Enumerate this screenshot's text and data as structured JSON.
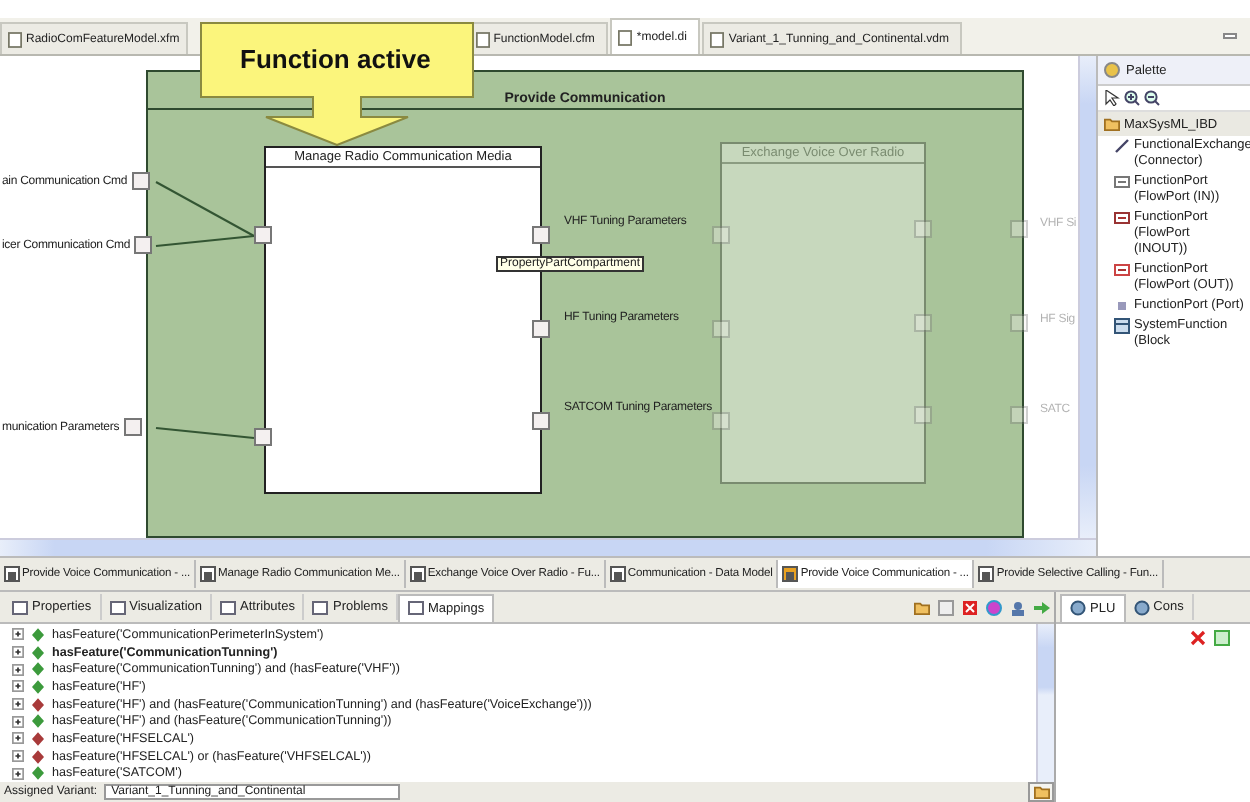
{
  "editor_tabs": [
    {
      "label": "RadioComFeatureModel.xfm",
      "selected": false
    },
    {
      "label": "FunctionModel.cfm",
      "selected": false
    },
    {
      "label": "*model.di",
      "selected": true
    },
    {
      "label": "Variant_1_Tunning_and_Continental.vdm",
      "selected": false
    }
  ],
  "callout": {
    "text": "Function active"
  },
  "diagram": {
    "frame_title": "Provide Communication",
    "blocks": [
      {
        "title": "Manage Radio Communication Media",
        "faded": false
      },
      {
        "title": "Exchange Voice Over Radio",
        "faded": true
      }
    ],
    "inputs": [
      "ain Communication Cmd",
      "icer Communication Cmd",
      "munication Parameters"
    ],
    "block_outputs": [
      "VHF Tuning Parameters",
      "HF Tuning Parameters",
      "SATCOM Tuning Parameters"
    ],
    "tooltip": "PropertyPartCompartment",
    "outputs": [
      "VHF Si",
      "HF Sig",
      "SATC"
    ]
  },
  "palette": {
    "title": "Palette",
    "drawer": "MaxSysML_IBD",
    "items": [
      {
        "label": "FunctionalExchange (Connector)",
        "kind": "connector"
      },
      {
        "label": "FunctionPort (FlowPort (IN))",
        "kind": "in"
      },
      {
        "label": "FunctionPort (FlowPort (INOUT))",
        "kind": "inout"
      },
      {
        "label": "FunctionPort (FlowPort (OUT))",
        "kind": "out"
      },
      {
        "label": "FunctionPort (Port)",
        "kind": "port"
      },
      {
        "label": "SystemFunction (Block",
        "kind": "block"
      }
    ]
  },
  "diagram_tabs": [
    {
      "label": "Provide Voice Communication - ...",
      "selected": false
    },
    {
      "label": "Manage Radio Communication Me...",
      "selected": false
    },
    {
      "label": "Exchange Voice Over Radio - Fu...",
      "selected": false
    },
    {
      "label": "Communication - Data Model",
      "selected": false
    },
    {
      "label": "Provide Voice Communication - ...",
      "selected": true
    },
    {
      "label": "Provide Selective Calling - Fun...",
      "selected": false
    }
  ],
  "view_tabs": [
    {
      "label": "Properties",
      "selected": false
    },
    {
      "label": "Visualization",
      "selected": false
    },
    {
      "label": "Attributes",
      "selected": false
    },
    {
      "label": "Problems",
      "selected": false
    },
    {
      "label": "Mappings",
      "selected": true
    }
  ],
  "side_tabs": [
    {
      "label": "PLU",
      "selected": true
    },
    {
      "label": "Cons",
      "selected": false
    }
  ],
  "mappings": [
    {
      "text": "hasFeature('CommunicationPerimeterInSystem')",
      "color": "#3c9a3c",
      "bold": false
    },
    {
      "text": "hasFeature('CommunicationTunning')",
      "color": "#3c9a3c",
      "bold": true
    },
    {
      "text": "hasFeature('CommunicationTunning') and (hasFeature('VHF'))",
      "color": "#3c9a3c",
      "bold": false
    },
    {
      "text": "hasFeature('HF')",
      "color": "#3c9a3c",
      "bold": false
    },
    {
      "text": "hasFeature('HF') and (hasFeature('CommunicationTunning') and (hasFeature('VoiceExchange')))",
      "color": "#a83a3a",
      "bold": false
    },
    {
      "text": "hasFeature('HF') and (hasFeature('CommunicationTunning'))",
      "color": "#3c9a3c",
      "bold": false
    },
    {
      "text": "hasFeature('HFSELCAL')",
      "color": "#a83a3a",
      "bold": false
    },
    {
      "text": "hasFeature('HFSELCAL') or (hasFeature('VHFSELCAL'))",
      "color": "#a83a3a",
      "bold": false
    },
    {
      "text": "hasFeature('SATCOM')",
      "color": "#3c9a3c",
      "bold": false
    }
  ],
  "status": {
    "label": "Assigned Variant:",
    "value": "Variant_1_Tunning_and_Continental"
  }
}
